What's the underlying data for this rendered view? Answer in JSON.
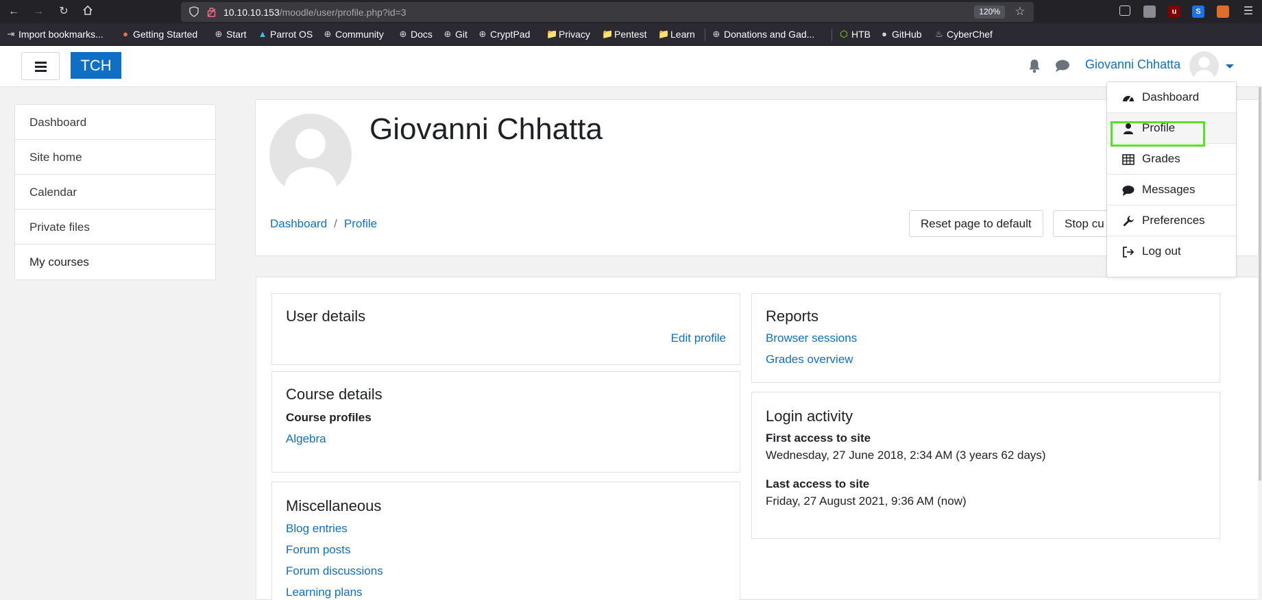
{
  "browser": {
    "url_host": "10.10.10.153",
    "url_path": "/moodle/user/profile.php?id=3",
    "zoom": "120%",
    "bookmarks": [
      {
        "label": "Import bookmarks...",
        "icon": "import-icon"
      },
      {
        "label": "Getting Started",
        "icon": "firefox-icon"
      },
      {
        "label": "Start",
        "icon": "globe-icon"
      },
      {
        "label": "Parrot OS",
        "icon": "parrot-icon"
      },
      {
        "label": "Community",
        "icon": "globe-icon"
      },
      {
        "label": "Docs",
        "icon": "globe-icon"
      },
      {
        "label": "Git",
        "icon": "globe-icon"
      },
      {
        "label": "CryptPad",
        "icon": "globe-icon"
      },
      {
        "label": "Privacy",
        "icon": "folder-icon"
      },
      {
        "label": "Pentest",
        "icon": "folder-icon"
      },
      {
        "label": "Learn",
        "icon": "folder-icon"
      },
      {
        "label": "Donations and Gad...",
        "icon": "globe-icon"
      },
      {
        "label": "HTB",
        "icon": "htb-icon"
      },
      {
        "label": "GitHub",
        "icon": "github-icon"
      },
      {
        "label": "CyberChef",
        "icon": "chef-icon"
      }
    ]
  },
  "navbar": {
    "brand": "TCH",
    "user_name": "Giovanni Chhatta"
  },
  "sidebar": {
    "items": [
      {
        "label": "Dashboard"
      },
      {
        "label": "Site home"
      },
      {
        "label": "Calendar"
      },
      {
        "label": "Private files"
      },
      {
        "label": "My courses"
      }
    ]
  },
  "header": {
    "title": "Giovanni Chhatta",
    "breadcrumb": [
      "Dashboard",
      "Profile"
    ],
    "breadcrumb_sep": "/",
    "reset_button": "Reset page to default",
    "stop_button": "Stop cu"
  },
  "user_details": {
    "title": "User details",
    "edit_link": "Edit profile"
  },
  "course_details": {
    "title": "Course details",
    "profiles_heading": "Course profiles",
    "course": "Algebra"
  },
  "misc": {
    "title": "Miscellaneous",
    "links": [
      "Blog entries",
      "Forum posts",
      "Forum discussions",
      "Learning plans"
    ]
  },
  "reports": {
    "title": "Reports",
    "links": [
      "Browser sessions",
      "Grades overview"
    ]
  },
  "login_activity": {
    "title": "Login activity",
    "first_heading": "First access to site",
    "first_value": "Wednesday, 27 June 2018, 2:34 AM  (3 years 62 days)",
    "last_heading": "Last access to site",
    "last_value": "Friday, 27 August 2021, 9:36 AM  (now)"
  },
  "user_menu": {
    "items": [
      {
        "label": "Dashboard",
        "icon": "dashboard-icon"
      },
      {
        "label": "Profile",
        "icon": "user-icon"
      },
      {
        "label": "Grades",
        "icon": "table-icon"
      },
      {
        "label": "Messages",
        "icon": "comment-icon"
      },
      {
        "label": "Preferences",
        "icon": "wrench-icon"
      },
      {
        "label": "Log out",
        "icon": "sign-out-icon"
      }
    ],
    "highlighted": "Profile",
    "highlight_color": "#59e024"
  },
  "colors": {
    "link": "#0f6fc5",
    "brand_bg": "#0f6fc5"
  }
}
